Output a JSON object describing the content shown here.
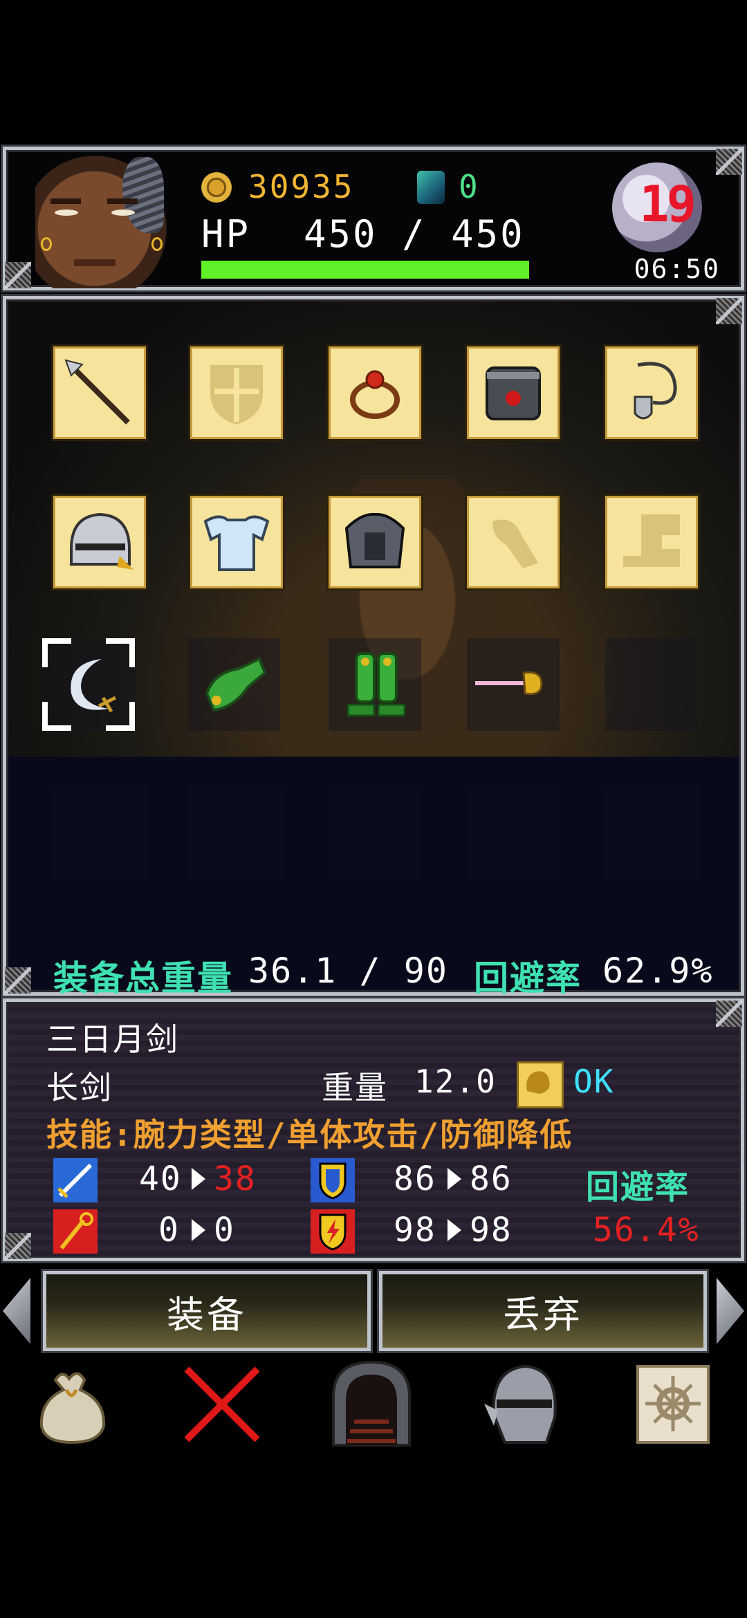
{
  "hud": {
    "gold": "30935",
    "gems": "0",
    "hp_label": "HP",
    "hp_value": "450 / 450",
    "hp_fraction": 1.0,
    "moon_day": "19",
    "clock": "06:50"
  },
  "inventory": {
    "slots_row1": [
      "spear-icon",
      "shield-icon",
      "ring-icon",
      "gauntlet-box-icon",
      "amulet-icon"
    ],
    "slots_row2": [
      "helmet-icon",
      "chest-armor-icon",
      "iron-armor-icon",
      "arm-guard-icon",
      "boots-icon"
    ],
    "row3_items": [
      "crescent-sword-icon",
      "green-gauntlet-icon",
      "green-boots-icon",
      "rapier-icon"
    ],
    "weight_label": "装备总重量",
    "weight_value": "36.1 / 90",
    "evasion_label": "回避率",
    "evasion_value": "62.9%"
  },
  "item": {
    "name": "三日月剑",
    "type": "长剑",
    "weight_label": "重量",
    "weight_value": "12.0",
    "strength_ok": "OK",
    "skill": "技能:腕力类型/单体攻击/防御降低",
    "attack_from": "40",
    "attack_to": "38",
    "magic_from": "0",
    "magic_to": "0",
    "defense_from": "86",
    "defense_to": "86",
    "mdefense_from": "98",
    "mdefense_to": "98",
    "evasion_label": "回避率",
    "evasion_value": "56.4%"
  },
  "actions": {
    "equip": "装备",
    "discard": "丢弃"
  },
  "nav": [
    "bag-icon",
    "close-icon",
    "door-icon",
    "knight-helmet-icon",
    "map-icon"
  ],
  "colors": {
    "gold": "#f2b632",
    "gem": "#4fe08a",
    "hp_bar": "#5ff02a",
    "teal": "#3fe0b2",
    "skill": "#f0a030",
    "decrease": "#e62020",
    "slot_bg": "#f6e39c"
  }
}
